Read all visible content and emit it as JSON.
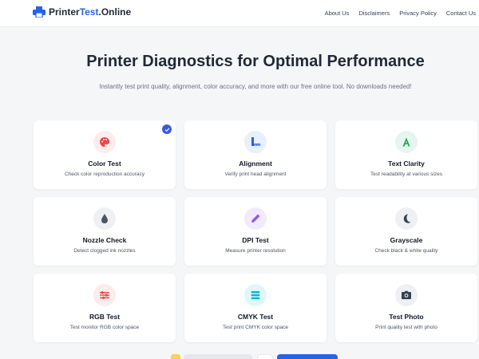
{
  "header": {
    "logo_part1": "Printer",
    "logo_part2": "Test",
    "logo_part3": ".Online",
    "nav": [
      "About Us",
      "Disclaimers",
      "Privacy Policy",
      "Contact Us"
    ]
  },
  "hero": {
    "title": "Printer Diagnostics for Optimal Performance",
    "subtitle": "Instantly test print quality, alignment, color accuracy, and more with our free online tool. No downloads needed!"
  },
  "cards": [
    {
      "title": "Color Test",
      "desc": "Check color reproduction accuracy",
      "icon": "palette-icon",
      "bg": "#fdecec",
      "color": "#ef4444"
    },
    {
      "title": "Alignment",
      "desc": "Verify print head alignment",
      "icon": "ruler-icon",
      "bg": "#e8efff",
      "color": "#2563eb"
    },
    {
      "title": "Text Clarity",
      "desc": "Test readability at various sizes",
      "icon": "font-icon",
      "bg": "#e6f6ee",
      "color": "#16a34a"
    },
    {
      "title": "Nozzle Check",
      "desc": "Detect clogged ink nozzles",
      "icon": "droplet-icon",
      "bg": "#eef0f3",
      "color": "#4b5563"
    },
    {
      "title": "DPI Test",
      "desc": "Measure printer resolution",
      "icon": "pen-icon",
      "bg": "#f2ebff",
      "color": "#8b5cf6"
    },
    {
      "title": "Grayscale",
      "desc": "Check black & white quality",
      "icon": "moon-icon",
      "bg": "#eef0f3",
      "color": "#374151"
    },
    {
      "title": "RGB Test",
      "desc": "Test monitor RGB color space",
      "icon": "sliders-icon",
      "bg": "#fdecec",
      "color": "#ef4444"
    },
    {
      "title": "CMYK Test",
      "desc": "Test print CMYK color space",
      "icon": "layers-icon",
      "bg": "#e0f7fa",
      "color": "#06b6d4"
    },
    {
      "title": "Test Photo",
      "desc": "Print quality test with photo",
      "icon": "camera-icon",
      "bg": "#eef0f3",
      "color": "#374151"
    }
  ],
  "colors": {
    "accent": "#2563eb",
    "check_badge": "#3b5bdb"
  }
}
